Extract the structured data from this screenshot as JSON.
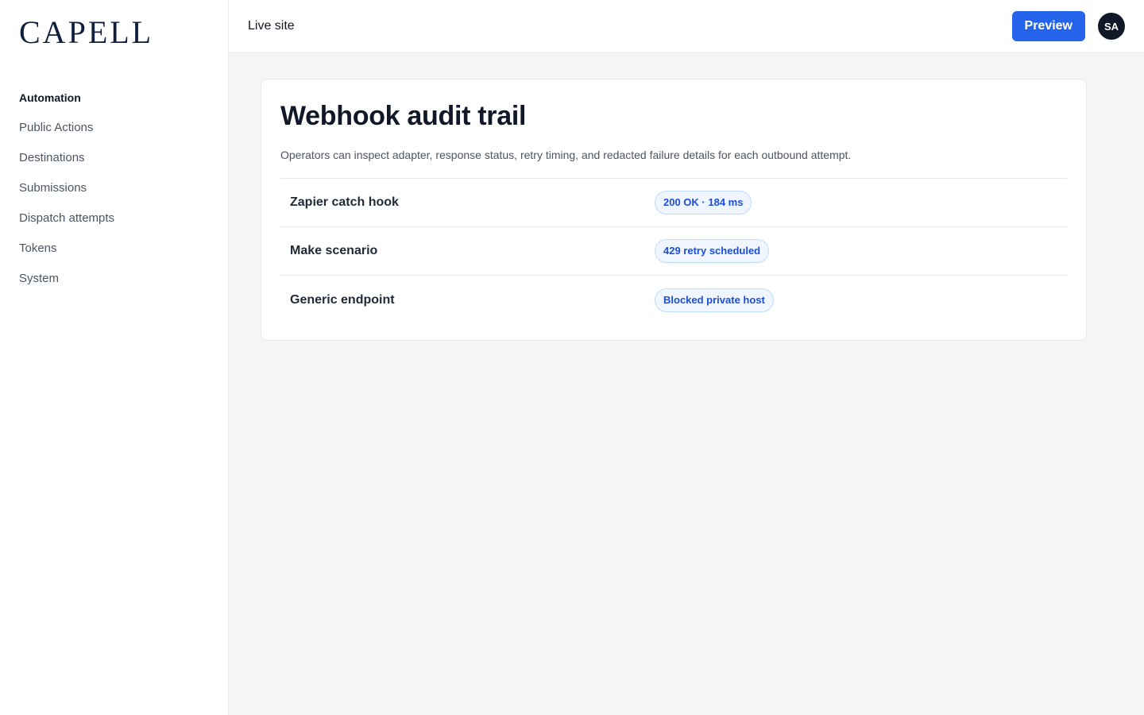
{
  "brand": {
    "logo_text": "CAPELL"
  },
  "sidebar": {
    "items": [
      {
        "label": "Automation",
        "section": true
      },
      {
        "label": "Public Actions"
      },
      {
        "label": "Destinations"
      },
      {
        "label": "Submissions"
      },
      {
        "label": "Dispatch attempts"
      },
      {
        "label": "Tokens"
      },
      {
        "label": "System"
      }
    ]
  },
  "topbar": {
    "live_site_label": "Live site",
    "preview_label": "Preview",
    "avatar_initials": "SA"
  },
  "card": {
    "title": "Webhook audit trail",
    "description": "Operators can inspect adapter, response status, retry timing, and redacted failure details for each outbound attempt.",
    "rows": [
      {
        "name": "Zapier catch hook",
        "status": "200 OK · 184 ms"
      },
      {
        "name": "Make scenario",
        "status": "429 retry scheduled"
      },
      {
        "name": "Generic endpoint",
        "status": "Blocked private host"
      }
    ]
  },
  "colors": {
    "accent": "#2563eb",
    "badge_text": "#1d4ed8",
    "badge_bg": "#eff6ff",
    "logo": "#0f1f3d"
  }
}
